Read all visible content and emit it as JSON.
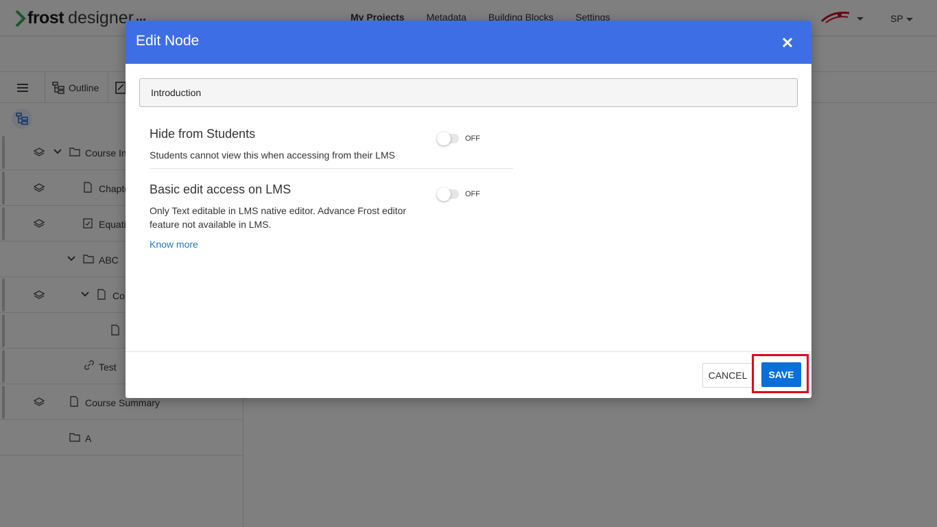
{
  "app": {
    "logo_bold": "frost",
    "logo_light": "designer",
    "more_label": "...",
    "nav": [
      "My Projects",
      "Metadata",
      "Building Blocks",
      "Settings"
    ],
    "user_initials": "SP"
  },
  "tabs": {
    "outline_label": "Outline"
  },
  "tree": {
    "items": [
      {
        "label": "Course In"
      },
      {
        "label": "Chapte"
      },
      {
        "label": "Equati"
      },
      {
        "label": "ABC"
      },
      {
        "label": "Co"
      },
      {
        "label": ""
      },
      {
        "label": "Test"
      },
      {
        "label": "Course Summary"
      },
      {
        "label": "A"
      }
    ]
  },
  "modal": {
    "title": "Edit Node",
    "name_value": "Introduction",
    "options": [
      {
        "title": "Hide from Students",
        "description": "Students cannot view this when accessing from their LMS",
        "toggle_state": "OFF"
      },
      {
        "title": "Basic edit access on LMS",
        "description": "Only Text editable in LMS native editor. Advance Frost editor feature not available in LMS.",
        "toggle_state": "OFF"
      }
    ],
    "know_more": "Know more",
    "cancel_label": "CANCEL",
    "save_label": "SAVE"
  },
  "colors": {
    "header_blue": "#3d6ee6",
    "save_blue": "#0a6fdb",
    "highlight_red": "#e0001b",
    "link_blue": "#1e7bbf"
  }
}
